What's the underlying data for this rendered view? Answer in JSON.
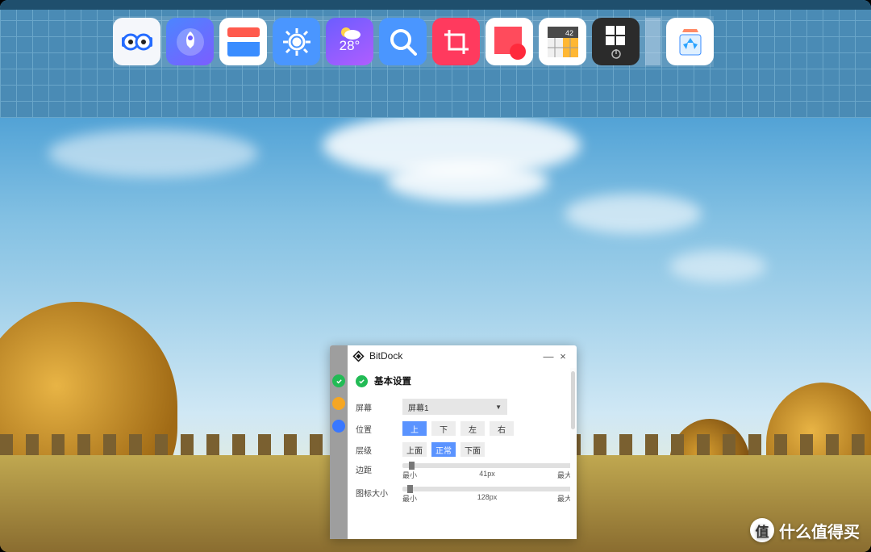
{
  "dock": {
    "weather_reading": "28°",
    "items": [
      {
        "name": "geek-app-icon"
      },
      {
        "name": "rocket-launcher-icon"
      },
      {
        "name": "files-folder-icon"
      },
      {
        "name": "settings-gear-icon"
      },
      {
        "name": "weather-icon"
      },
      {
        "name": "search-icon"
      },
      {
        "name": "screenshot-crop-icon"
      },
      {
        "name": "sticky-notes-icon"
      },
      {
        "name": "calculator-icon"
      },
      {
        "name": "start-menu-icon"
      },
      {
        "name": "recycle-bin-icon"
      }
    ]
  },
  "settings": {
    "app_title": "BitDock",
    "section_title": "基本设置",
    "screen_label": "屏幕",
    "screen_value": "屏幕1",
    "position_label": "位置",
    "position_options": {
      "top": "上",
      "bottom": "下",
      "left": "左",
      "right": "右"
    },
    "layer_label": "层级",
    "layer_options": {
      "above": "上面",
      "normal": "正常",
      "below": "下面"
    },
    "margin_label": "边距",
    "margin_value": "41px",
    "icon_size_label": "图标大小",
    "icon_size_value": "128px",
    "scale": {
      "min": "最小",
      "max": "最大"
    },
    "minimize": "—",
    "close": "×"
  },
  "watermark": {
    "badge": "值",
    "text": "什么值得买"
  }
}
